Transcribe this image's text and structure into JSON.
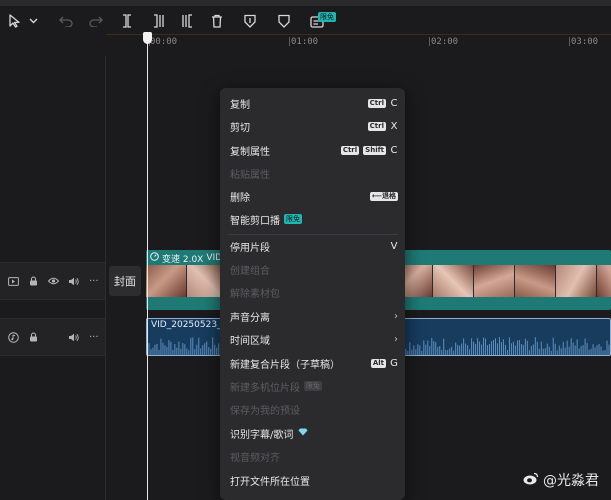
{
  "toolbar": {
    "free_badge": "限免"
  },
  "ruler": {
    "marks": [
      "00:00",
      "01:00",
      "02:00",
      "03:00"
    ]
  },
  "tracks": {
    "cover_label": "封面"
  },
  "video_clip": {
    "speed_label": "变速 2.0X",
    "name": "VID"
  },
  "audio_clip": {
    "name": "VID_20250523_1"
  },
  "context_menu": {
    "copy": "复制",
    "copy_keys": [
      "Ctrl"
    ],
    "copy_key": "C",
    "cut": "剪切",
    "cut_keys": [
      "Ctrl"
    ],
    "cut_key": "X",
    "copy_props": "复制属性",
    "copy_props_keys": [
      "Ctrl",
      "Shift"
    ],
    "copy_props_key": "C",
    "paste_props": "粘贴属性",
    "delete": "删除",
    "delete_key": "⟵退格",
    "smart_cut": "智能剪口播",
    "smart_cut_badge": "限免",
    "disable_clip": "停用片段",
    "disable_clip_key": "V",
    "create_combo": "创建组合",
    "unlink": "解除素材包",
    "audio_separate": "声音分离",
    "time_range": "时间区域",
    "new_compound": "新建复合片段（子草稿）",
    "new_compound_keys": [
      "Alt"
    ],
    "new_compound_key": "G",
    "new_multicam": "新建多机位片段",
    "new_multicam_badge": "限免",
    "save_preset": "保存为我的预设",
    "recognize_lyrics": "识别字幕/歌词",
    "video_align": "视音频对齐",
    "open_location": "打开文件所在位置"
  },
  "watermark": "@光淼君",
  "colors": {
    "accent_teal": "#1fb5b1",
    "video_clip": "#1f7a75",
    "audio_clip": "#173c5e"
  }
}
